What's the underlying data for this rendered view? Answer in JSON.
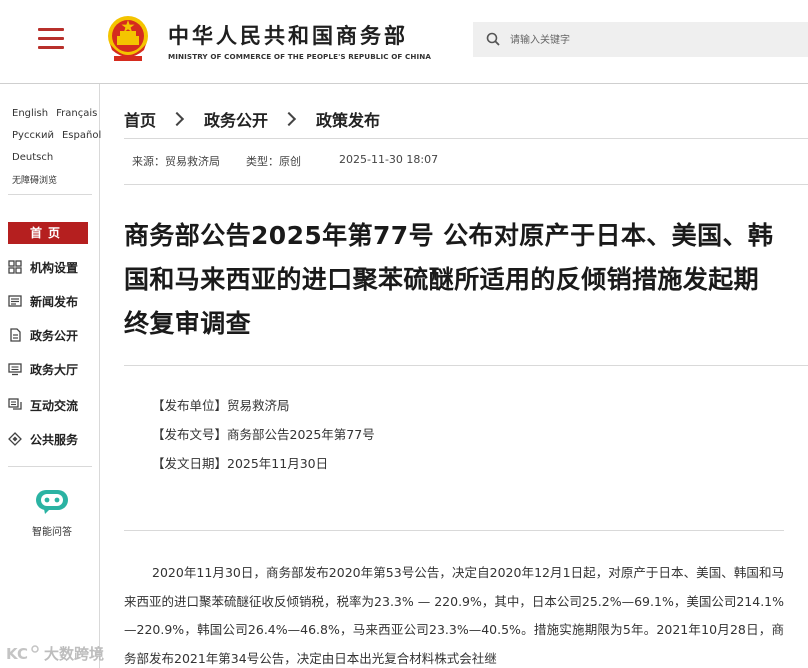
{
  "header": {
    "brand_cn": "中华人民共和国商务部",
    "brand_en": "MINISTRY OF COMMERCE OF THE PEOPLE'S REPUBLIC OF CHINA",
    "search_placeholder": "请输入关键字"
  },
  "sidebar": {
    "languages": [
      [
        "English",
        "Français"
      ],
      [
        "Русский",
        "Español"
      ],
      [
        "Deutsch"
      ],
      [
        "无障碍浏览"
      ]
    ],
    "home_label": "首页",
    "nav_items": [
      {
        "icon": "grid-icon",
        "label": "机构设置"
      },
      {
        "icon": "news-icon",
        "label": "新闻发布"
      },
      {
        "icon": "document-icon",
        "label": "政务公开"
      },
      {
        "icon": "monitor-icon",
        "label": "政务大厅"
      },
      {
        "icon": "chat-icon",
        "label": "互动交流"
      },
      {
        "icon": "service-icon",
        "label": "公共服务"
      }
    ],
    "assistant_label": "智能问答"
  },
  "breadcrumb": [
    "首页",
    "政务公开",
    "政策发布"
  ],
  "meta": {
    "source": "来源：贸易救济局",
    "type": "类型：原创",
    "date": "2025-11-30 18:07"
  },
  "article": {
    "title": "商务部公告2025年第77号 公布对原产于日本、美国、韩国和马来西亚的进口聚苯硫醚所适用的反倾销措施发起期终复审调查",
    "info": [
      "【发布单位】贸易救济局",
      "【发布文号】商务部公告2025年第77号",
      "【发文日期】2025年11月30日"
    ],
    "body": "2020年11月30日，商务部发布2020年第53号公告，决定自2020年12月1日起，对原产于日本、美国、韩国和马来西亚的进口聚苯硫醚征收反倾销税，税率为23.3% — 220.9%，其中，日本公司25.2%—69.1%，美国公司214.1%—220.9%，韩国公司26.4%—46.8%，马来西亚公司23.3%—40.5%。措施实施期限为5年。2021年10月28日，商务部发布2021年第34号公告，决定由日本出光复合材料株式会社继"
  },
  "watermark": "大数跨境",
  "colors": {
    "accent_red": "#b51f1f",
    "assistant_teal": "#2bb3a3"
  }
}
